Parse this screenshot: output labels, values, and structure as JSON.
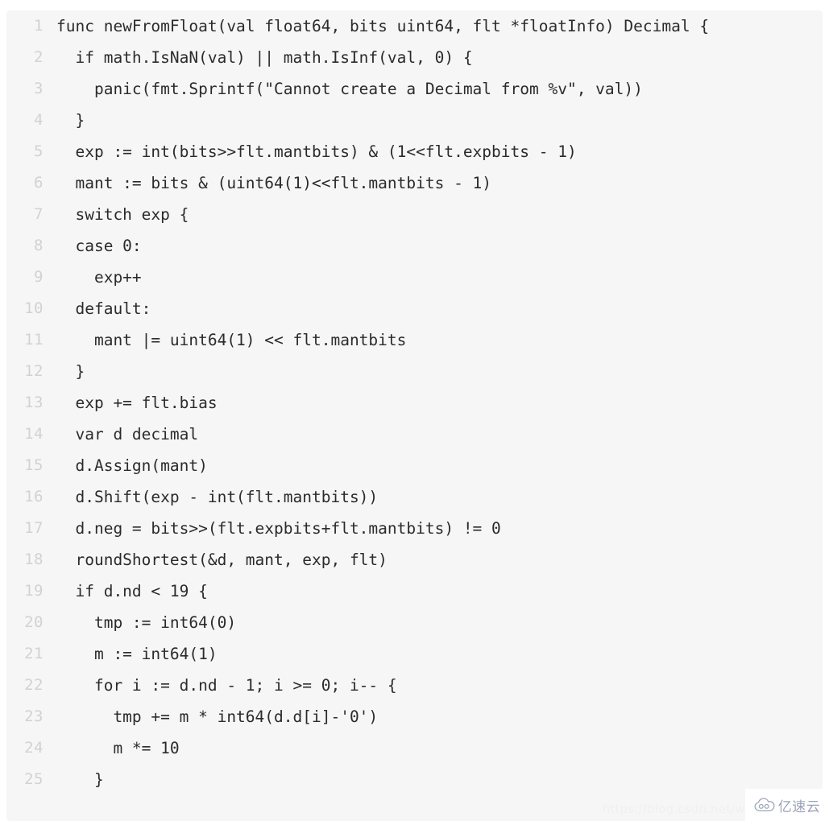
{
  "code_block": {
    "language": "go",
    "background_color": "#f6f6f6",
    "text_color": "#2b2b2b",
    "line_number_color": "#d2d2d2",
    "lines": [
      {
        "number": "1",
        "text": "func newFromFloat(val float64, bits uint64, flt *floatInfo) Decimal {"
      },
      {
        "number": "2",
        "text": "  if math.IsNaN(val) || math.IsInf(val, 0) {"
      },
      {
        "number": "3",
        "text": "    panic(fmt.Sprintf(\"Cannot create a Decimal from %v\", val))"
      },
      {
        "number": "4",
        "text": "  }"
      },
      {
        "number": "5",
        "text": "  exp := int(bits>>flt.mantbits) & (1<<flt.expbits - 1)"
      },
      {
        "number": "6",
        "text": "  mant := bits & (uint64(1)<<flt.mantbits - 1)"
      },
      {
        "number": "7",
        "text": "  switch exp {"
      },
      {
        "number": "8",
        "text": "  case 0:"
      },
      {
        "number": "9",
        "text": "    exp++"
      },
      {
        "number": "10",
        "text": "  default:"
      },
      {
        "number": "11",
        "text": "    mant |= uint64(1) << flt.mantbits"
      },
      {
        "number": "12",
        "text": "  }"
      },
      {
        "number": "13",
        "text": "  exp += flt.bias"
      },
      {
        "number": "14",
        "text": "  var d decimal"
      },
      {
        "number": "15",
        "text": "  d.Assign(mant)"
      },
      {
        "number": "16",
        "text": "  d.Shift(exp - int(flt.mantbits))"
      },
      {
        "number": "17",
        "text": "  d.neg = bits>>(flt.expbits+flt.mantbits) != 0"
      },
      {
        "number": "18",
        "text": "  roundShortest(&d, mant, exp, flt)"
      },
      {
        "number": "19",
        "text": "  if d.nd < 19 {"
      },
      {
        "number": "20",
        "text": "    tmp := int64(0)"
      },
      {
        "number": "21",
        "text": "    m := int64(1)"
      },
      {
        "number": "22",
        "text": "    for i := d.nd - 1; i >= 0; i-- {"
      },
      {
        "number": "23",
        "text": "      tmp += m * int64(d.d[i]-'0')"
      },
      {
        "number": "24",
        "text": "      m *= 10"
      },
      {
        "number": "25",
        "text": "    }"
      }
    ]
  },
  "watermark": {
    "text": "https://blog.csdn.net/w",
    "color": "#f0f0f0"
  },
  "brand": {
    "icon": "cloud-icon",
    "text": "亿速云",
    "color": "#9aa3b5"
  }
}
